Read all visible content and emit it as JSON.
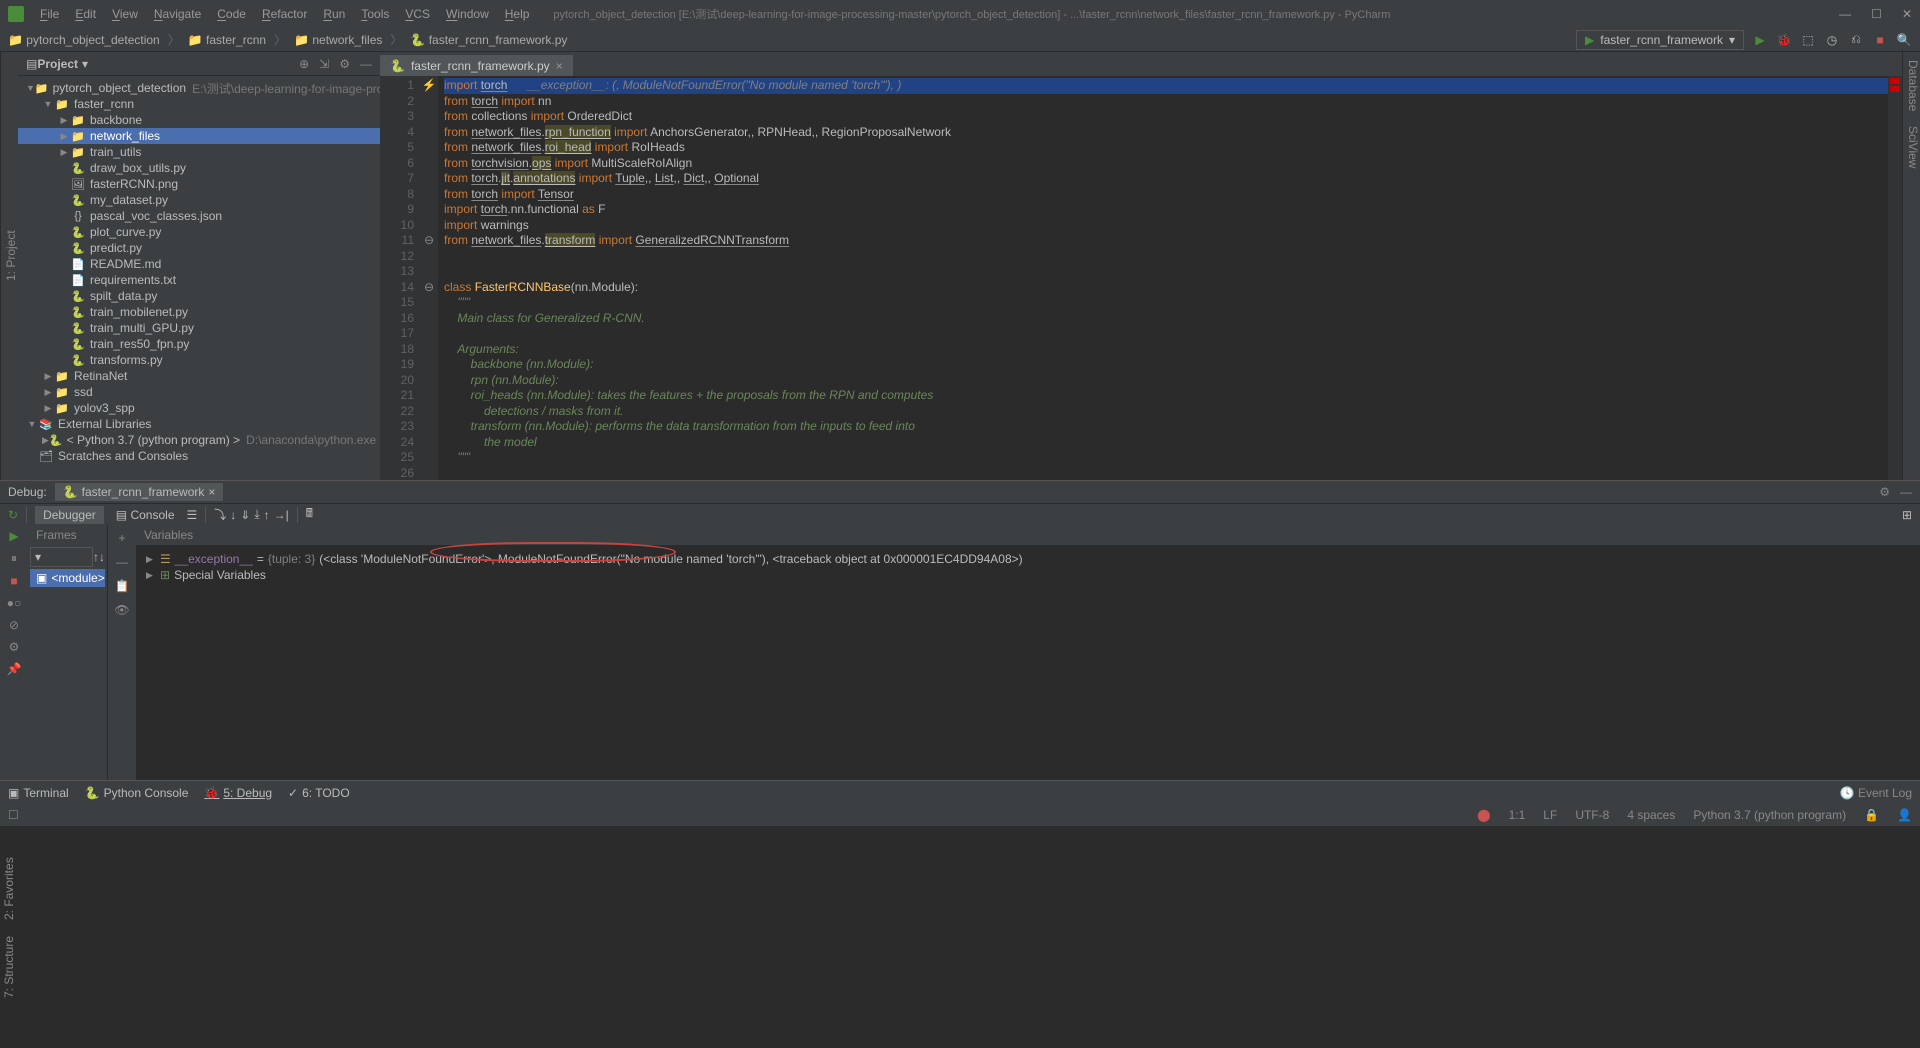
{
  "title": {
    "menu": [
      "File",
      "Edit",
      "View",
      "Navigate",
      "Code",
      "Refactor",
      "Run",
      "Tools",
      "VCS",
      "Window",
      "Help"
    ],
    "path": "pytorch_object_detection [E:\\测试\\deep-learning-for-image-processing-master\\pytorch_object_detection] - ...\\faster_rcnn\\network_files\\faster_rcnn_framework.py - PyCharm"
  },
  "breadcrumbs": [
    "pytorch_object_detection",
    "faster_rcnn",
    "network_files",
    "faster_rcnn_framework.py"
  ],
  "runconfig": "faster_rcnn_framework",
  "project": {
    "title": "Project",
    "tree": [
      {
        "lvl": 0,
        "arrow": "▼",
        "icon": "📁",
        "label": "pytorch_object_detection",
        "suf": "E:\\测试\\deep-learning-for-image-processing-m",
        "sel": false
      },
      {
        "lvl": 1,
        "arrow": "▼",
        "icon": "📁",
        "label": "faster_rcnn",
        "sel": false
      },
      {
        "lvl": 2,
        "arrow": "▶",
        "icon": "📁",
        "label": "backbone",
        "sel": false
      },
      {
        "lvl": 2,
        "arrow": "▶",
        "icon": "📁",
        "label": "network_files",
        "sel": true
      },
      {
        "lvl": 2,
        "arrow": "▶",
        "icon": "📁",
        "label": "train_utils",
        "sel": false
      },
      {
        "lvl": 2,
        "arrow": "",
        "icon": "🐍",
        "label": "draw_box_utils.py",
        "sel": false
      },
      {
        "lvl": 2,
        "arrow": "",
        "icon": "🖼",
        "label": "fasterRCNN.png",
        "sel": false
      },
      {
        "lvl": 2,
        "arrow": "",
        "icon": "🐍",
        "label": "my_dataset.py",
        "sel": false
      },
      {
        "lvl": 2,
        "arrow": "",
        "icon": "{}",
        "label": "pascal_voc_classes.json",
        "sel": false
      },
      {
        "lvl": 2,
        "arrow": "",
        "icon": "🐍",
        "label": "plot_curve.py",
        "sel": false
      },
      {
        "lvl": 2,
        "arrow": "",
        "icon": "🐍",
        "label": "predict.py",
        "sel": false
      },
      {
        "lvl": 2,
        "arrow": "",
        "icon": "📄",
        "label": "README.md",
        "sel": false
      },
      {
        "lvl": 2,
        "arrow": "",
        "icon": "📄",
        "label": "requirements.txt",
        "sel": false
      },
      {
        "lvl": 2,
        "arrow": "",
        "icon": "🐍",
        "label": "spilt_data.py",
        "sel": false
      },
      {
        "lvl": 2,
        "arrow": "",
        "icon": "🐍",
        "label": "train_mobilenet.py",
        "sel": false
      },
      {
        "lvl": 2,
        "arrow": "",
        "icon": "🐍",
        "label": "train_multi_GPU.py",
        "sel": false
      },
      {
        "lvl": 2,
        "arrow": "",
        "icon": "🐍",
        "label": "train_res50_fpn.py",
        "sel": false
      },
      {
        "lvl": 2,
        "arrow": "",
        "icon": "🐍",
        "label": "transforms.py",
        "sel": false
      },
      {
        "lvl": 1,
        "arrow": "▶",
        "icon": "📁",
        "label": "RetinaNet",
        "sel": false
      },
      {
        "lvl": 1,
        "arrow": "▶",
        "icon": "📁",
        "label": "ssd",
        "sel": false
      },
      {
        "lvl": 1,
        "arrow": "▶",
        "icon": "📁",
        "label": "yolov3_spp",
        "sel": false
      },
      {
        "lvl": 0,
        "arrow": "▼",
        "icon": "📚",
        "label": "External Libraries",
        "sel": false
      },
      {
        "lvl": 1,
        "arrow": "▶",
        "icon": "🐍",
        "label": "< Python 3.7 (python program) >",
        "suf": "D:\\anaconda\\python.exe",
        "sel": false
      },
      {
        "lvl": 0,
        "arrow": "",
        "icon": "🗂",
        "label": "Scratches and Consoles",
        "sel": false
      }
    ]
  },
  "editor": {
    "tab": "faster_rcnn_framework.py",
    "inlay": "__exception__: (<class 'ModuleNotFoundError'>, ModuleNotFoundError(\"No module named 'torch'\"), <traceback object at 0x000001EC4DD94A08>)",
    "lines": [
      {
        "n": 1,
        "mark": "⚡",
        "hl": true,
        "seg": [
          [
            "kw",
            "import "
          ],
          [
            "und",
            "torch"
          ]
        ]
      },
      {
        "n": 2,
        "seg": [
          [
            "kw",
            "from "
          ],
          [
            "und",
            "torch"
          ],
          [
            "kw",
            " import "
          ],
          [
            "",
            "nn"
          ]
        ]
      },
      {
        "n": 3,
        "seg": [
          [
            "kw",
            "from "
          ],
          [
            "",
            "collections"
          ],
          [
            "kw",
            " import "
          ],
          [
            "",
            "OrderedDict"
          ]
        ]
      },
      {
        "n": 4,
        "seg": [
          [
            "kw",
            "from "
          ],
          [
            "und",
            "network_files"
          ],
          [
            "",
            "."
          ],
          [
            "und-y",
            "rpn_function"
          ],
          [
            "kw",
            " import "
          ],
          [
            "",
            "AnchorsGenerator"
          ],
          [
            "",
            ","
          ],
          [
            "",
            ", RPNHead"
          ],
          [
            "",
            ","
          ],
          [
            "",
            ", RegionProposalNetwork"
          ]
        ]
      },
      {
        "n": 5,
        "seg": [
          [
            "kw",
            "from "
          ],
          [
            "und",
            "network_files"
          ],
          [
            "",
            "."
          ],
          [
            "und-y",
            "roi_head"
          ],
          [
            "kw",
            " import "
          ],
          [
            "",
            "RoIHeads"
          ]
        ]
      },
      {
        "n": 6,
        "seg": [
          [
            "kw",
            "from "
          ],
          [
            "und",
            "torchvision"
          ],
          [
            "",
            "."
          ],
          [
            "und-y",
            "ops"
          ],
          [
            "kw",
            " import "
          ],
          [
            "",
            "MultiScaleRoIAlign"
          ]
        ]
      },
      {
        "n": 7,
        "seg": [
          [
            "kw",
            "from "
          ],
          [
            "und",
            "torch"
          ],
          [
            "",
            "."
          ],
          [
            "und-y",
            "jit"
          ],
          [
            "",
            "."
          ],
          [
            "und-y",
            "annotations"
          ],
          [
            "kw",
            " import "
          ],
          [
            "und",
            "Tuple"
          ],
          [
            "",
            ","
          ],
          [
            "",
            ", "
          ],
          [
            "und",
            "List"
          ],
          [
            "",
            ","
          ],
          [
            "",
            ", "
          ],
          [
            "und",
            "Dict"
          ],
          [
            "",
            ","
          ],
          [
            "",
            ", "
          ],
          [
            "und",
            "Optional"
          ]
        ]
      },
      {
        "n": 8,
        "seg": [
          [
            "kw",
            "from "
          ],
          [
            "und",
            "torch"
          ],
          [
            "kw",
            " import "
          ],
          [
            "und",
            "Tensor"
          ]
        ]
      },
      {
        "n": 9,
        "seg": [
          [
            "kw",
            "import "
          ],
          [
            "und",
            "torch"
          ],
          [
            "",
            ".nn.functional "
          ],
          [
            "kw",
            "as "
          ],
          [
            "",
            "F"
          ]
        ]
      },
      {
        "n": 10,
        "seg": [
          [
            "kw",
            "import "
          ],
          [
            "",
            "warnings"
          ]
        ]
      },
      {
        "n": 11,
        "mark": "⊖",
        "seg": [
          [
            "kw",
            "from "
          ],
          [
            "und",
            "network_files"
          ],
          [
            "",
            "."
          ],
          [
            "und-y",
            "transform"
          ],
          [
            "kw",
            " import "
          ],
          [
            "und",
            "GeneralizedRCNNTransform"
          ]
        ]
      },
      {
        "n": 12,
        "seg": []
      },
      {
        "n": 13,
        "seg": []
      },
      {
        "n": 14,
        "mark": "⊖",
        "seg": [
          [
            "kw",
            "class "
          ],
          [
            "cls",
            "FasterRCNNBase"
          ],
          [
            "",
            "(nn.Module):"
          ]
        ]
      },
      {
        "n": 15,
        "seg": [
          [
            "",
            "    "
          ],
          [
            "str",
            "\"\"\""
          ]
        ]
      },
      {
        "n": 16,
        "seg": [
          [
            "",
            "    "
          ],
          [
            "str",
            "Main class for Generalized R-CNN."
          ]
        ]
      },
      {
        "n": 17,
        "seg": []
      },
      {
        "n": 18,
        "seg": [
          [
            "",
            "    "
          ],
          [
            "str",
            "Arguments:"
          ]
        ]
      },
      {
        "n": 19,
        "seg": [
          [
            "",
            "        "
          ],
          [
            "str",
            "backbone (nn.Module):"
          ]
        ]
      },
      {
        "n": 20,
        "seg": [
          [
            "",
            "        "
          ],
          [
            "str",
            "rpn (nn.Module):"
          ]
        ]
      },
      {
        "n": 21,
        "seg": [
          [
            "",
            "        "
          ],
          [
            "str",
            "roi_heads (nn.Module): takes the features + the proposals from the RPN and computes"
          ]
        ]
      },
      {
        "n": 22,
        "seg": [
          [
            "",
            "            "
          ],
          [
            "str",
            "detections / masks from it."
          ]
        ]
      },
      {
        "n": 23,
        "seg": [
          [
            "",
            "        "
          ],
          [
            "str",
            "transform (nn.Module): performs the data transformation from the inputs to feed into"
          ]
        ]
      },
      {
        "n": 24,
        "seg": [
          [
            "",
            "            "
          ],
          [
            "str",
            "the model"
          ]
        ]
      },
      {
        "n": 25,
        "seg": [
          [
            "",
            "    "
          ],
          [
            "str",
            "\"\"\""
          ]
        ]
      },
      {
        "n": 26,
        "seg": []
      }
    ]
  },
  "debug": {
    "label": "Debug:",
    "tab": "faster_rcnn_framework",
    "debuggerTab": "Debugger",
    "consoleTab": "Console",
    "framesLabel": "Frames",
    "varsLabel": "Variables",
    "frameItem": "<module>",
    "var1_name": "__exception__",
    "var1_type": "{tuple: 3}",
    "var1_val": "(<class 'ModuleNotFoundError'>, ModuleNotFoundError(\"No module named 'torch'\"), <traceback object at 0x000001EC4DD94A08>)",
    "var1_mid": "ModuleNotFoundError(\"No module named 'torch'\")",
    "var2": "Special Variables"
  },
  "bottomTabs": {
    "terminal": "Terminal",
    "pyconsole": "Python Console",
    "debug": "5: Debug",
    "todo": "6: TODO",
    "eventlog": "Event Log"
  },
  "status": {
    "pos": "1:1",
    "le": "LF",
    "enc": "UTF-8",
    "indent": "4 spaces",
    "interp": "Python 3.7 (python program)"
  },
  "sidebars": {
    "project": "1: Project",
    "favorites": "2: Favorites",
    "structure": "7: Structure",
    "database": "Database",
    "sciview": "SciView"
  }
}
